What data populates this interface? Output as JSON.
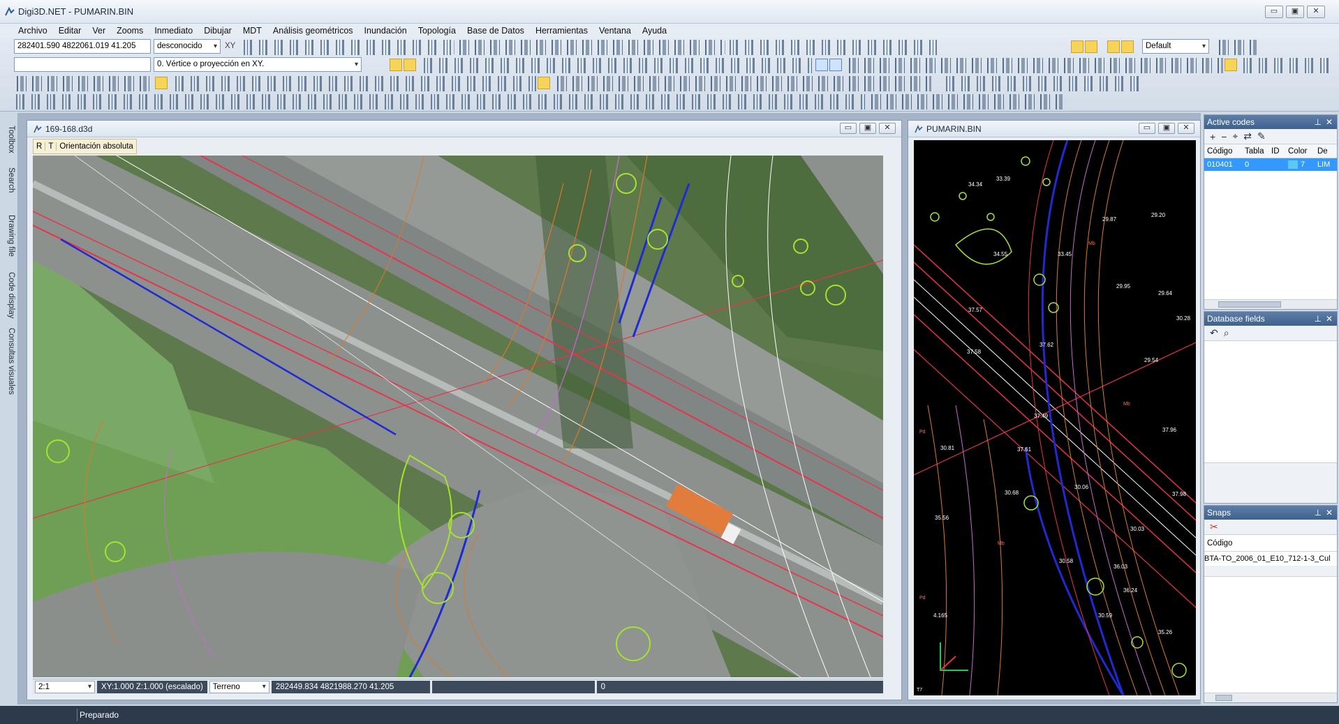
{
  "window": {
    "title": "Digi3D.NET - PUMARIN.BIN",
    "buttons": [
      "▭",
      "▣",
      "✕"
    ]
  },
  "menu": [
    "Archivo",
    "Editar",
    "Ver",
    "Zooms",
    "Inmediato",
    "Dibujar",
    "MDT",
    "Análisis geométricos",
    "Inundación",
    "Topología",
    "Base de Datos",
    "Herramientas",
    "Ventana",
    "Ayuda"
  ],
  "toolbar": {
    "coords_field": "282401.590 4822061.019 41.205",
    "layer_select": "desconocido",
    "xy_label": "XY",
    "command_field": "",
    "snap_select": "0. Vértice o proyección en XY.",
    "style_select": "Default"
  },
  "sidetabs": [
    "Toolbox",
    "Search",
    "Drawing file",
    "Code display",
    "Consultas visuales"
  ],
  "left_view": {
    "title": "169-168.d3d",
    "buttons": [
      "▭",
      "▣",
      "✕"
    ],
    "tool_r": "R",
    "tool_t": "T",
    "orientation_label": "Orientación absoluta",
    "status": {
      "scale": "2:1",
      "scale_info": "XY:1.000 Z:1.000 (escalado)",
      "terrain": "Terreno",
      "coords": "282449.834 4821988.270 41.205",
      "counter": "0"
    }
  },
  "right_view": {
    "title": "PUMARIN.BIN",
    "buttons": [
      "▭",
      "▣",
      "✕"
    ],
    "labels": [
      "33.39",
      "34.34",
      "29.87",
      "29.20",
      "34.55",
      "33.45",
      "29.95",
      "29.64",
      "37.57",
      "30.28",
      "37.58",
      "37.62",
      "29.54",
      "37.49",
      "30.81",
      "37.61",
      "37.96",
      "37.98",
      "30.06",
      "30.68",
      "30.03",
      "35.56",
      "30.58",
      "36.03",
      "30.59",
      "36.24",
      "35.26",
      "4.165",
      "Pd",
      "Mb",
      "Mb",
      "Mb",
      "Pd",
      "T7"
    ]
  },
  "active_codes": {
    "title": "Active codes",
    "tools": [
      "+",
      "−",
      "⌖",
      "⇄",
      "✎"
    ],
    "columns": [
      "Código",
      "Tabla",
      "ID",
      "Color",
      "De"
    ],
    "rows": [
      {
        "codigo": "010401",
        "tabla": "0",
        "id": "",
        "color": "7",
        "de": "LIM"
      }
    ],
    "color_swatch": "#5bc8f5"
  },
  "database_fields": {
    "title": "Database fields",
    "tools": [
      "↶",
      "⌕"
    ]
  },
  "snaps": {
    "title": "Snaps",
    "column": "Código",
    "row": "BTA-TO_2006_01_E10_712-1-3_Cul"
  },
  "statusbar": {
    "text": "Preparado"
  },
  "colors": {
    "accent_blue": "#3f618e",
    "selection": "#3399ff",
    "contour_red": "#e8334a",
    "contour_orange": "#d97a2b",
    "vegetation_green": "#a6e22e",
    "water_blue": "#1f2bd1"
  }
}
